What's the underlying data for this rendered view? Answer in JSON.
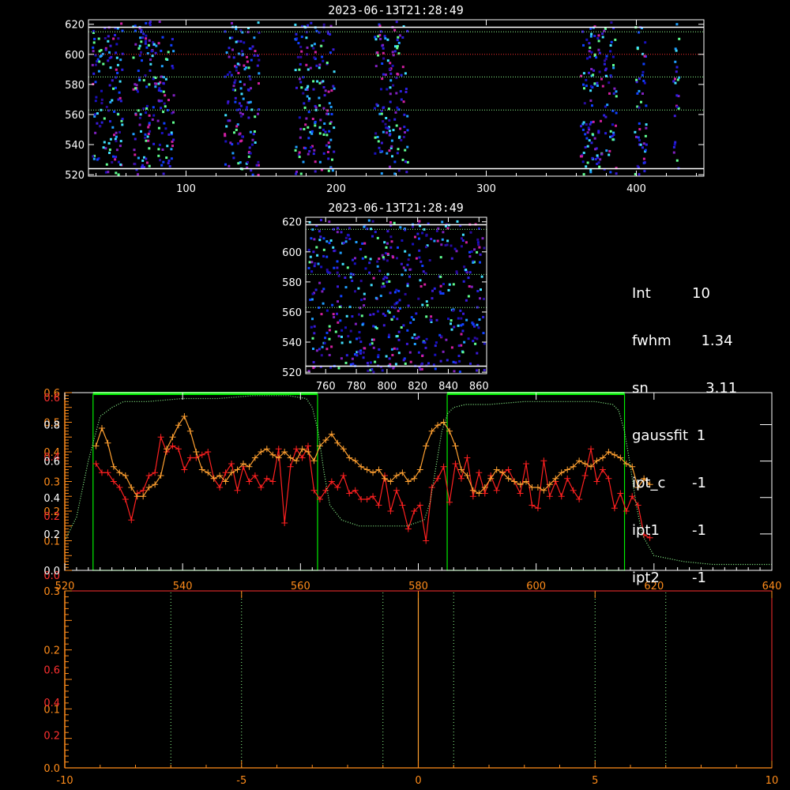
{
  "colors": {
    "background": "#000000",
    "axes": "#ffffff",
    "lower_axes": "#ff8c1a",
    "lower_ticks": "#ff3030",
    "green_dotted": "#90ff90",
    "red_dotted": "#ff3030",
    "box_green": "#00ee00",
    "series_red": "#ff2020",
    "series_orange": "#ffa030",
    "center_line": "#ffa030"
  },
  "info_panel": [
    {
      "key": "Int",
      "value": "10"
    },
    {
      "key": "fwhm",
      "value": "1.34"
    },
    {
      "key": "sn",
      "value": "3.11"
    },
    {
      "key": "gaussfit",
      "value": "1"
    },
    {
      "key": "ipt_c",
      "value": "-1"
    },
    {
      "key": "ipt1",
      "value": "-1"
    },
    {
      "key": "ipt2",
      "value": "-1"
    }
  ],
  "chart_data": [
    {
      "type": "heatmap",
      "title": "2023-06-13T21:28:49",
      "xlim": [
        35,
        445
      ],
      "ylim": [
        519,
        623
      ],
      "x_ticks": [
        100,
        200,
        300,
        400
      ],
      "y_ticks": [
        520,
        540,
        560,
        580,
        600,
        620
      ],
      "hlines": [
        {
          "y": 524,
          "style": "solid",
          "color": "#ffffff"
        },
        {
          "y": 618,
          "style": "solid",
          "color": "#ffffff"
        },
        {
          "y": 563,
          "style": "dotted",
          "color": "#90ff90"
        },
        {
          "y": 585,
          "style": "dotted",
          "color": "#90ff90"
        },
        {
          "y": 615,
          "style": "dotted",
          "color": "#90ff90"
        },
        {
          "y": 600,
          "style": "dotted",
          "color": "#ff3030"
        }
      ],
      "signal_bands": [
        [
          37,
          57
        ],
        [
          64,
          92
        ],
        [
          125,
          148
        ],
        [
          172,
          198
        ],
        [
          225,
          247
        ],
        [
          362,
          386
        ],
        [
          398,
          406
        ],
        [
          424,
          428
        ]
      ]
    },
    {
      "type": "heatmap",
      "title": "2023-06-13T21:28:49",
      "xlim": [
        747,
        865
      ],
      "ylim": [
        519,
        623
      ],
      "x_ticks": [
        760,
        780,
        800,
        820,
        840,
        860
      ],
      "y_ticks": [
        520,
        540,
        560,
        580,
        600,
        620
      ],
      "hlines": [
        {
          "y": 524,
          "style": "solid",
          "color": "#ffffff"
        },
        {
          "y": 618,
          "style": "solid",
          "color": "#ffffff"
        },
        {
          "y": 563,
          "style": "dotted",
          "color": "#90ff90"
        },
        {
          "y": 585,
          "style": "dotted",
          "color": "#90ff90"
        },
        {
          "y": 615,
          "style": "dotted",
          "color": "#90ff90"
        }
      ]
    },
    {
      "type": "line",
      "xlim": [
        520,
        640
      ],
      "x_ticks": [
        520,
        540,
        560,
        580,
        600,
        620,
        640
      ],
      "ylim": [
        0,
        0.6
      ],
      "y_labels_white": [
        "0.0",
        "0.2",
        "0.4",
        "0.6",
        "0.8"
      ],
      "y_labels_white_values": [
        0.0,
        0.123,
        0.246,
        0.369,
        0.492
      ],
      "y_labels_orange": [
        "0.1",
        "0.2",
        "0.3",
        "0.4",
        "0.5",
        "0.6"
      ],
      "y_labels_orange_values": [
        0.1,
        0.2,
        0.3,
        0.4,
        0.5,
        0.6
      ],
      "y_labels_red": [
        "0.0",
        "0.2",
        "0.4",
        "0.6"
      ],
      "y_labels_red_values": [
        0.0,
        0.2,
        0.4,
        0.6
      ],
      "boxes": [
        {
          "x0": 524.8,
          "x1": 562.9
        },
        {
          "x0": 584.9,
          "x1": 615.0
        }
      ],
      "series": [
        {
          "color": "#ff2020",
          "marker": "plus",
          "x": [
            525.3,
            526.3,
            527.3,
            528.3,
            529.3,
            530.3,
            531.3,
            532.3,
            533.3,
            534.3,
            535.3,
            536.3,
            537.3,
            538.3,
            539.3,
            540.3,
            541.3,
            542.3,
            543.3,
            544.3,
            545.3,
            546.3,
            547.3,
            548.3,
            549.3,
            550.3,
            551.3,
            552.3,
            553.3,
            554.3,
            555.3,
            556.3,
            557.3,
            558.3,
            559.3,
            560.3,
            561.3,
            562.3,
            563.3,
            564.3,
            565.3,
            566.3,
            567.3,
            568.3,
            569.3,
            570.3,
            571.3,
            572.3,
            573.3,
            574.3,
            575.3,
            576.3,
            577.3,
            578.3,
            579.3,
            580.3,
            581.3,
            582.3,
            583.3,
            584.3,
            585.3,
            586.3,
            587.3,
            588.3,
            589.3,
            590.3,
            591.3,
            592.3,
            593.3,
            594.3,
            595.3,
            596.3,
            597.3,
            598.3,
            599.3,
            600.3,
            601.3,
            602.3,
            603.3,
            604.3,
            605.3,
            606.3,
            607.3,
            608.3,
            609.3,
            610.3,
            611.3,
            612.3,
            613.3,
            614.3,
            615.3,
            616.3,
            617.3,
            618.3,
            619.3
          ],
          "y": [
            0.36,
            0.33,
            0.33,
            0.3,
            0.28,
            0.24,
            0.17,
            0.26,
            0.27,
            0.32,
            0.33,
            0.45,
            0.4,
            0.42,
            0.41,
            0.34,
            0.38,
            0.38,
            0.39,
            0.4,
            0.31,
            0.28,
            0.33,
            0.36,
            0.27,
            0.35,
            0.3,
            0.32,
            0.28,
            0.31,
            0.3,
            0.41,
            0.16,
            0.35,
            0.41,
            0.38,
            0.42,
            0.27,
            0.24,
            0.27,
            0.3,
            0.28,
            0.32,
            0.26,
            0.27,
            0.24,
            0.24,
            0.25,
            0.22,
            0.32,
            0.2,
            0.27,
            0.22,
            0.14,
            0.2,
            0.22,
            0.1,
            0.28,
            0.31,
            0.35,
            0.23,
            0.36,
            0.31,
            0.38,
            0.25,
            0.33,
            0.26,
            0.32,
            0.27,
            0.33,
            0.34,
            0.3,
            0.26,
            0.36,
            0.22,
            0.21,
            0.37,
            0.25,
            0.3,
            0.25,
            0.31,
            0.27,
            0.24,
            0.32,
            0.41,
            0.3,
            0.34,
            0.31,
            0.21,
            0.26,
            0.2,
            0.25,
            0.22,
            0.12,
            0.11
          ]
        },
        {
          "color": "#ffa030",
          "marker": "plus",
          "x": [
            525.3,
            526.3,
            527.3,
            528.3,
            529.3,
            530.3,
            531.3,
            532.3,
            533.3,
            534.3,
            535.3,
            536.3,
            537.3,
            538.3,
            539.3,
            540.3,
            541.3,
            542.3,
            543.3,
            544.3,
            545.3,
            546.3,
            547.3,
            548.3,
            549.3,
            550.3,
            551.3,
            552.3,
            553.3,
            554.3,
            555.3,
            556.3,
            557.3,
            558.3,
            559.3,
            560.3,
            561.3,
            562.3,
            563.3,
            564.3,
            565.3,
            566.3,
            567.3,
            568.3,
            569.3,
            570.3,
            571.3,
            572.3,
            573.3,
            574.3,
            575.3,
            576.3,
            577.3,
            578.3,
            579.3,
            580.3,
            581.3,
            582.3,
            583.3,
            584.3,
            585.3,
            586.3,
            587.3,
            588.3,
            589.3,
            590.3,
            591.3,
            592.3,
            593.3,
            594.3,
            595.3,
            596.3,
            597.3,
            598.3,
            599.3,
            600.3,
            601.3,
            602.3,
            603.3,
            604.3,
            605.3,
            606.3,
            607.3,
            608.3,
            609.3,
            610.3,
            611.3,
            612.3,
            613.3,
            614.3,
            615.3,
            616.3,
            617.3,
            618.3,
            619.3
          ],
          "y": [
            0.42,
            0.48,
            0.43,
            0.35,
            0.33,
            0.32,
            0.28,
            0.25,
            0.25,
            0.28,
            0.29,
            0.32,
            0.41,
            0.45,
            0.49,
            0.52,
            0.47,
            0.4,
            0.34,
            0.33,
            0.31,
            0.32,
            0.3,
            0.33,
            0.34,
            0.36,
            0.35,
            0.38,
            0.4,
            0.41,
            0.39,
            0.38,
            0.4,
            0.38,
            0.37,
            0.41,
            0.4,
            0.37,
            0.42,
            0.44,
            0.46,
            0.43,
            0.41,
            0.38,
            0.37,
            0.35,
            0.34,
            0.33,
            0.34,
            0.31,
            0.3,
            0.32,
            0.33,
            0.3,
            0.31,
            0.34,
            0.42,
            0.47,
            0.49,
            0.5,
            0.47,
            0.42,
            0.34,
            0.32,
            0.27,
            0.26,
            0.28,
            0.31,
            0.34,
            0.33,
            0.31,
            0.3,
            0.29,
            0.3,
            0.28,
            0.28,
            0.27,
            0.29,
            0.31,
            0.33,
            0.34,
            0.35,
            0.37,
            0.36,
            0.35,
            0.37,
            0.38,
            0.4,
            0.39,
            0.38,
            0.36,
            0.35,
            0.28,
            0.31,
            0.29
          ]
        },
        {
          "color": "#90ff90",
          "style": "dotted",
          "x": [
            520,
            522,
            524,
            526,
            528,
            530,
            534,
            540,
            546,
            552,
            558,
            561,
            562,
            563,
            564,
            565,
            567,
            570,
            574,
            578,
            581,
            582,
            583,
            584,
            585,
            586,
            588,
            592,
            598,
            604,
            610,
            613,
            614,
            615,
            616,
            617,
            618,
            620,
            625,
            630,
            635,
            640
          ],
          "y": [
            0.1,
            0.18,
            0.37,
            0.52,
            0.55,
            0.57,
            0.57,
            0.58,
            0.58,
            0.59,
            0.59,
            0.58,
            0.55,
            0.47,
            0.33,
            0.22,
            0.17,
            0.15,
            0.15,
            0.15,
            0.17,
            0.23,
            0.35,
            0.47,
            0.53,
            0.55,
            0.56,
            0.56,
            0.57,
            0.57,
            0.57,
            0.56,
            0.54,
            0.47,
            0.35,
            0.22,
            0.12,
            0.05,
            0.03,
            0.02,
            0.02,
            0.02
          ]
        }
      ]
    },
    {
      "type": "line",
      "xlim": [
        -10,
        10
      ],
      "x_ticks": [
        -10,
        -5,
        0,
        5,
        10
      ],
      "ylim": [
        0,
        0.3
      ],
      "y_labels_orange": [
        "0.0",
        "0.1",
        "0.2",
        "0.3"
      ],
      "y_labels_orange_values": [
        0.0,
        0.1,
        0.2,
        0.3
      ],
      "y_labels_red": [
        "0.2",
        "0.4",
        "0.6"
      ],
      "y_labels_red_values": [
        0.0555,
        0.111,
        0.1665
      ],
      "vlines_dotted": [
        -7,
        -5,
        -1,
        1,
        5,
        7
      ],
      "vline_solid": 0
    }
  ]
}
